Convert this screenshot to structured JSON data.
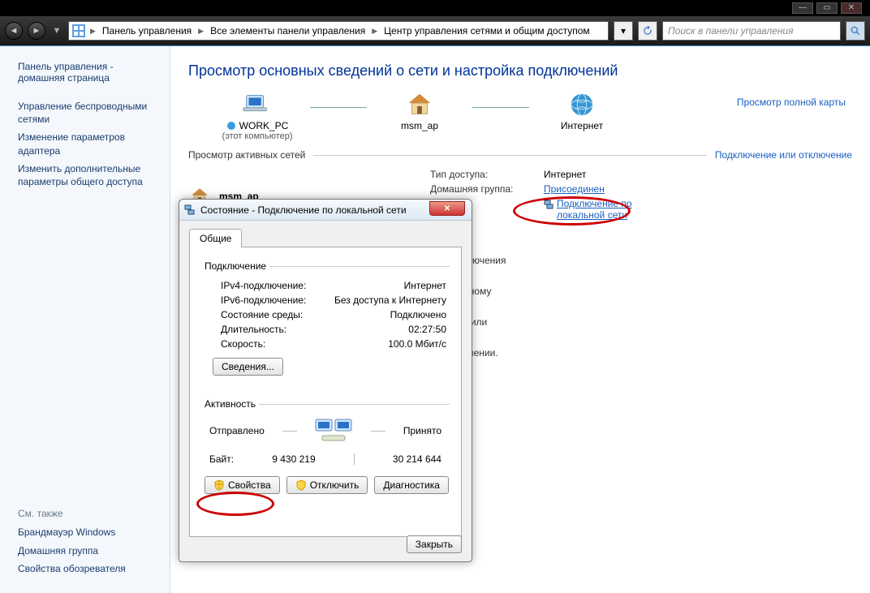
{
  "breadcrumb": {
    "p1": "Панель управления",
    "p2": "Все элементы панели управления",
    "p3": "Центр управления сетями и общим доступом"
  },
  "search": {
    "placeholder": "Поиск в панели управления"
  },
  "sidebar": {
    "home1": "Панель управления -",
    "home2": "домашняя страница",
    "link1": "Управление беспроводными сетями",
    "link2": "Изменение параметров адаптера",
    "link3": "Изменить дополнительные параметры общего доступа",
    "see_also": "См. также",
    "sa1": "Брандмауэр Windows",
    "sa2": "Домашняя группа",
    "sa3": "Свойства обозревателя"
  },
  "main": {
    "title": "Просмотр основных сведений о сети и настройка подключений",
    "map_link": "Просмотр полной карты",
    "node1": "WORK_PC",
    "node1_sub": "(этот компьютер)",
    "node2": "msm_ap",
    "node3": "Интернет",
    "active_networks": "Просмотр активных сетей",
    "connect_disconnect": "Подключение или отключение",
    "netname": "msm_ap",
    "details": {
      "k1": "Тип доступа:",
      "v1": "Интернет",
      "k2": "Домашняя группа:",
      "v2": "Присоединен",
      "k3": "ния:",
      "v3a": "Подключение по",
      "v3b": "локальной сети"
    },
    "frag1": ", прямого или VPN-подключения",
    "frag2": "ому, проводному, модемному",
    "frag3": "х сетевых компьютерах, или",
    "frag4": "ние сведений об исправлении."
  },
  "modal": {
    "title": "Состояние - Подключение по локальной сети",
    "tab": "Общие",
    "grp_connection": "Подключение",
    "rows": {
      "ipv4_k": "IPv4-подключение:",
      "ipv4_v": "Интернет",
      "ipv6_k": "IPv6-подключение:",
      "ipv6_v": "Без доступа к Интернету",
      "media_k": "Состояние среды:",
      "media_v": "Подключено",
      "dur_k": "Длительность:",
      "dur_v": "02:27:50",
      "speed_k": "Скорость:",
      "speed_v": "100.0 Мбит/с"
    },
    "details_btn": "Сведения...",
    "grp_activity": "Активность",
    "sent": "Отправлено",
    "recv": "Принято",
    "bytes_label": "Байт:",
    "bytes_sent": "9 430 219",
    "bytes_recv": "30 214 644",
    "btn_props": "Свойства",
    "btn_disable": "Отключить",
    "btn_diag": "Диагностика",
    "btn_close": "Закрыть"
  }
}
